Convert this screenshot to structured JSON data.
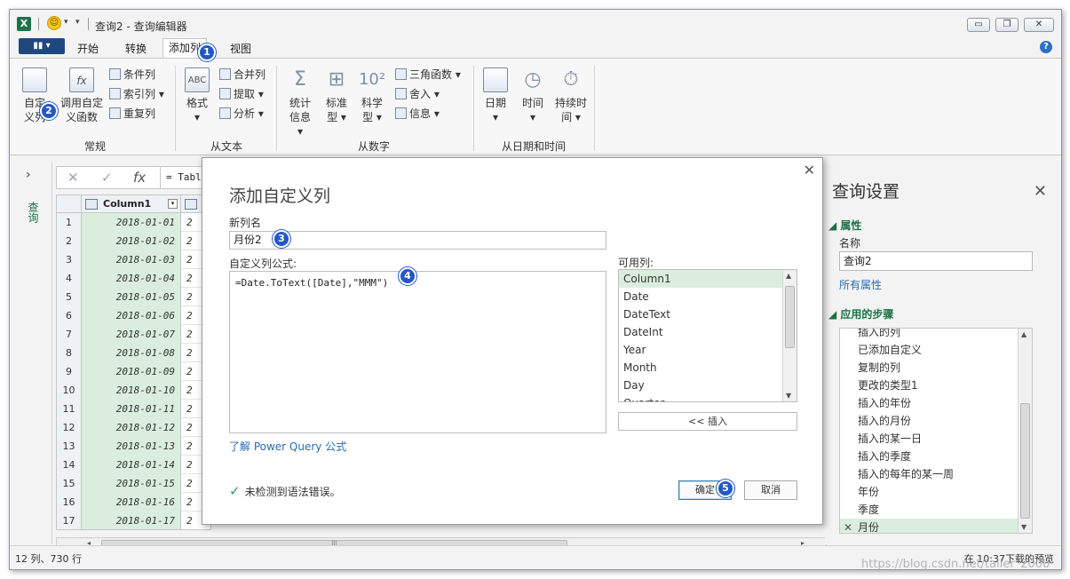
{
  "titlebar": {
    "app_icon": "X",
    "title": "查询2 - 查询编辑器",
    "buttons": [
      "minimize-icon",
      "restore-icon",
      "close-icon"
    ]
  },
  "tabs": {
    "file_label": "▮▮ ▾",
    "items": [
      "开始",
      "转换",
      "添加列",
      "视图"
    ],
    "active": "添加列"
  },
  "ribbon": {
    "groups": {
      "general": "常规",
      "from_text": "从文本",
      "from_number": "从数字",
      "from_datetime": "从日期和时间"
    },
    "custom_col": "自定义列",
    "invoke_func": "调用自定义函数",
    "cond_col": "条件列",
    "index_col": "索引列 ▾",
    "dup_col": "重复列",
    "format": "格式 ▾",
    "merge_cols": "合并列",
    "extract": "提取 ▾",
    "parse": "分析 ▾",
    "statistics": "统计信息 ▾",
    "standard": "标准型 ▾",
    "scientific": "科学型 ▾",
    "trig": "三角函数 ▾",
    "rounding": "舍入 ▾",
    "info": "信息 ▾",
    "date": "日期 ▾",
    "time": "时间 ▾",
    "duration": "持续时间 ▾"
  },
  "left_rail": {
    "label": "查询"
  },
  "formula_bar": {
    "value": "= Table"
  },
  "grid": {
    "column": "Column1",
    "rows": [
      {
        "n": "1",
        "v": "2018-01-01",
        "c2": "2"
      },
      {
        "n": "2",
        "v": "2018-01-02",
        "c2": "2"
      },
      {
        "n": "3",
        "v": "2018-01-03",
        "c2": "2"
      },
      {
        "n": "4",
        "v": "2018-01-04",
        "c2": "2"
      },
      {
        "n": "5",
        "v": "2018-01-05",
        "c2": "2"
      },
      {
        "n": "6",
        "v": "2018-01-06",
        "c2": "2"
      },
      {
        "n": "7",
        "v": "2018-01-07",
        "c2": "2"
      },
      {
        "n": "8",
        "v": "2018-01-08",
        "c2": "2"
      },
      {
        "n": "9",
        "v": "2018-01-09",
        "c2": "2"
      },
      {
        "n": "10",
        "v": "2018-01-10",
        "c2": "2"
      },
      {
        "n": "11",
        "v": "2018-01-11",
        "c2": "2"
      },
      {
        "n": "12",
        "v": "2018-01-12",
        "c2": "2"
      },
      {
        "n": "13",
        "v": "2018-01-13",
        "c2": "2"
      },
      {
        "n": "14",
        "v": "2018-01-14",
        "c2": "2"
      },
      {
        "n": "15",
        "v": "2018-01-15",
        "c2": "2"
      },
      {
        "n": "16",
        "v": "2018-01-16",
        "c2": "2"
      },
      {
        "n": "17",
        "v": "2018-01-17",
        "c2": "2"
      },
      {
        "n": "18",
        "v": "",
        "c2": ""
      }
    ]
  },
  "dialog": {
    "title": "添加自定义列",
    "new_col_label": "新列名",
    "new_col_value": "月份2",
    "formula_label": "自定义列公式:",
    "formula_value": "=Date.ToText([Date],\"MMM\")",
    "available_label": "可用列:",
    "available": [
      "Column1",
      "Date",
      "DateText",
      "DateInt",
      "Year",
      "Month",
      "Day",
      "Quarter"
    ],
    "insert_btn": "<< 插入",
    "learn_link": "了解 Power Query 公式",
    "status": "未检测到语法错误。",
    "ok": "确定",
    "cancel": "取消"
  },
  "query_settings": {
    "title": "查询设置",
    "props_header": "属性",
    "name_label": "名称",
    "name_value": "查询2",
    "all_props": "所有属性",
    "steps_header": "应用的步骤",
    "steps": [
      "插入的列",
      "已添加自定义",
      "复制的列",
      "更改的类型1",
      "插入的年份",
      "插入的月份",
      "插入的某一日",
      "插入的季度",
      "插入的每年的某一周",
      "年份",
      "季度",
      "月份"
    ],
    "selected_step": "月份"
  },
  "status": {
    "left": "12 列、730 行",
    "right": "在 10:37下载的预览"
  },
  "watermark": "https://blog.csdn.net/taller_2000",
  "badges": [
    "1",
    "2",
    "3",
    "4",
    "5"
  ],
  "colors": {
    "accent": "#1e7145",
    "badge": "#2457c5",
    "selected": "#dbeedd",
    "link": "#2b6aaf"
  }
}
